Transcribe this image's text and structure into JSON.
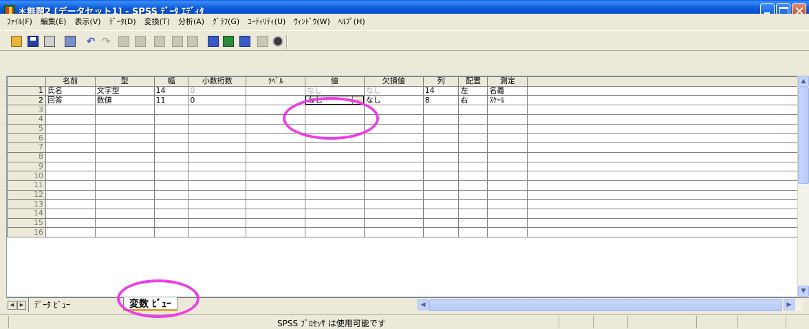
{
  "window": {
    "title": "＊無題2 [データセット1] - SPSS ﾃﾞｰﾀ ｴﾃﾞｨﾀ"
  },
  "menu": [
    "ﾌｧｲﾙ(F)",
    "編集(E)",
    "表示(V)",
    "ﾃﾞｰﾀ(D)",
    "変換(T)",
    "分析(A)",
    "ｸﾞﾗﾌ(G)",
    "ﾕｰﾃｨﾘﾃｨ(U)",
    "ｳｨﾝﾄﾞｳ(W)",
    "ﾍﾙﾌﾟ(H)"
  ],
  "toolbar": {
    "icons": [
      "open-folder-icon",
      "save-icon",
      "print-icon",
      "dialog-recall-icon",
      "undo-icon",
      "redo-icon",
      "goto-case-icon",
      "variables-icon",
      "find-icon",
      "insert-case-icon",
      "insert-variable-icon",
      "split-file-icon",
      "weight-cases-icon",
      "select-cases-icon",
      "value-labels-icon",
      "use-sets-icon"
    ]
  },
  "grid": {
    "headers": [
      "名前",
      "型",
      "幅",
      "小数桁数",
      "ﾗﾍﾞﾙ",
      "値",
      "欠損値",
      "列",
      "配置",
      "測定"
    ],
    "rows": [
      {
        "num": "1",
        "cells": [
          "氏名",
          "文字型",
          "14",
          "0",
          "",
          "なし",
          "なし",
          "14",
          "左",
          "名義"
        ]
      },
      {
        "num": "2",
        "cells": [
          "回答",
          "数値",
          "11",
          "0",
          "",
          "なし",
          "なし",
          "8",
          "右",
          "ｽｹｰﾙ"
        ]
      }
    ],
    "empty_row_numbers": [
      "3",
      "4",
      "5",
      "6",
      "7",
      "8",
      "9",
      "10",
      "11",
      "12",
      "13",
      "14",
      "15",
      "16"
    ],
    "editing_cell_button": "..."
  },
  "tabs": {
    "data_view": "ﾃﾞｰﾀ ﾋﾞｭｰ",
    "variable_view": "変数 ﾋﾞｭｰ"
  },
  "status": {
    "text": "SPSS ﾌﾟﾛｾｯｻ は使用可能です"
  },
  "colors": {
    "titlebar": "#0b5ad8",
    "annotation": "#ec3fe5",
    "active_tab_underline": "#e6a23c"
  }
}
